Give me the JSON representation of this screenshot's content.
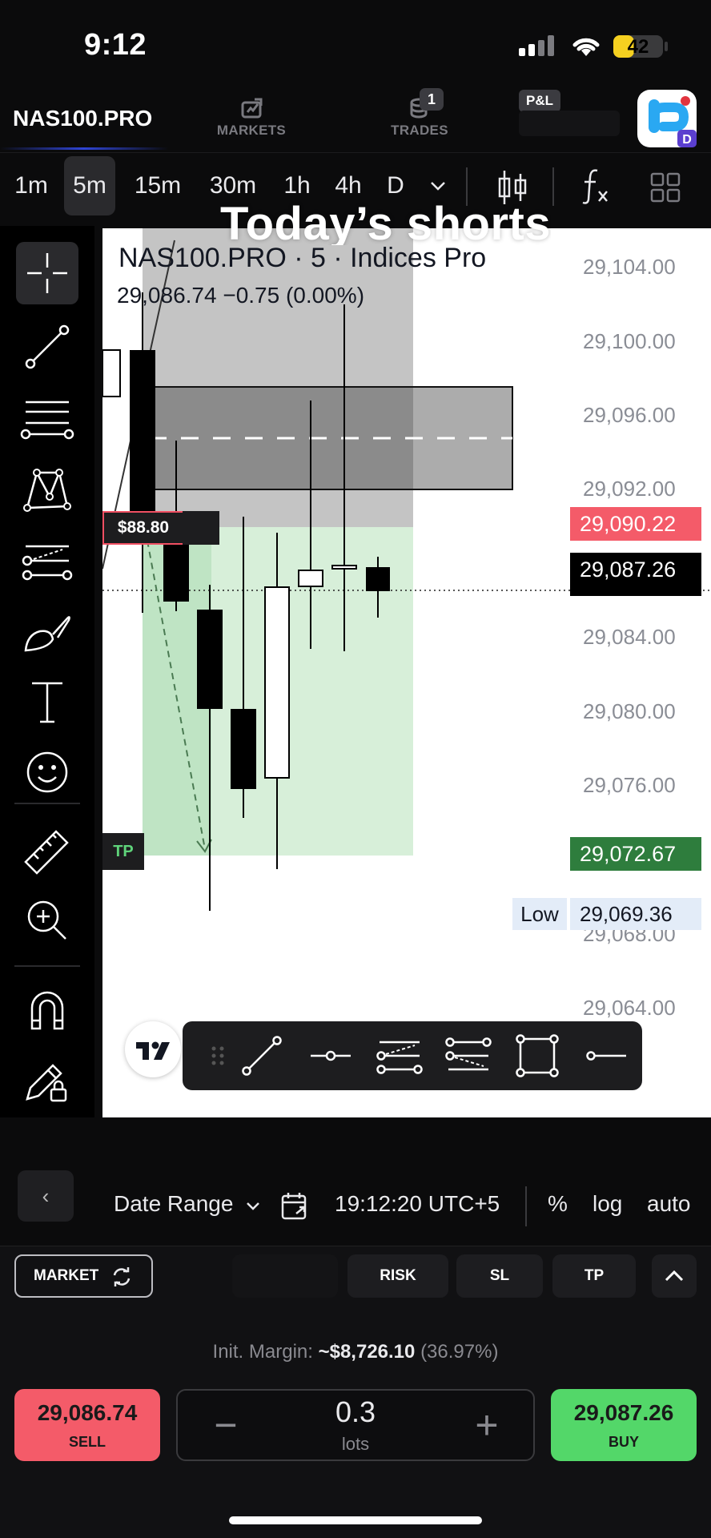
{
  "status_bar": {
    "time": "9:12",
    "battery": 42
  },
  "header": {
    "symbol": "NAS100.PRO",
    "nav": [
      {
        "label": "MARKETS",
        "icon": "markets-icon"
      },
      {
        "label": "TRADES",
        "icon": "trades-icon",
        "badge": "1"
      }
    ],
    "pnl_label": "P&L"
  },
  "timeframes": {
    "items": [
      "1m",
      "5m",
      "15m",
      "30m",
      "1h",
      "4h",
      "D"
    ],
    "active": "5m"
  },
  "overlay_caption": "Today’s shorts",
  "chart": {
    "legend_title": "NAS100.PRO · 5 · Indices Pro",
    "legend_values": "29,086.74  −0.75 (0.00%)",
    "price_labels": [
      "29,104.00",
      "29,100.00",
      "29,096.00",
      "29,092.00",
      "29,084.00",
      "29,080.00",
      "29,076.00",
      "29,068.00",
      "29,064.00"
    ],
    "tag_red": "29,090.22",
    "tag_current": "29,087.26",
    "tag_green": "29,072.67",
    "low_label": "Low",
    "low_value": "29,069.36",
    "pnl_tag": "$88.80",
    "tp_tag": "TP",
    "colors": {
      "sl_zone": "#bdbdbd",
      "tp_zone": "#d7efd9",
      "tag_red": "#f45b69",
      "tag_green": "#2e7d3d"
    }
  },
  "date_bar": {
    "back": "‹",
    "date_range": "Date Range",
    "time": "19:12:20 UTC+5",
    "percent": "%",
    "log": "log",
    "auto": "auto"
  },
  "order_panel": {
    "market_label": "MARKET",
    "risk_label": "RISK",
    "sl_label": "SL",
    "tp_label": "TP",
    "margin_label": "Init. Margin:",
    "margin_value": "~$8,726.10",
    "margin_pct": "(36.97%)",
    "sell_price": "29,086.74",
    "sell_label": "SELL",
    "buy_price": "29,087.26",
    "buy_label": "BUY",
    "lots_value": "0.3",
    "lots_unit": "lots",
    "minus": "−",
    "plus": "+"
  }
}
